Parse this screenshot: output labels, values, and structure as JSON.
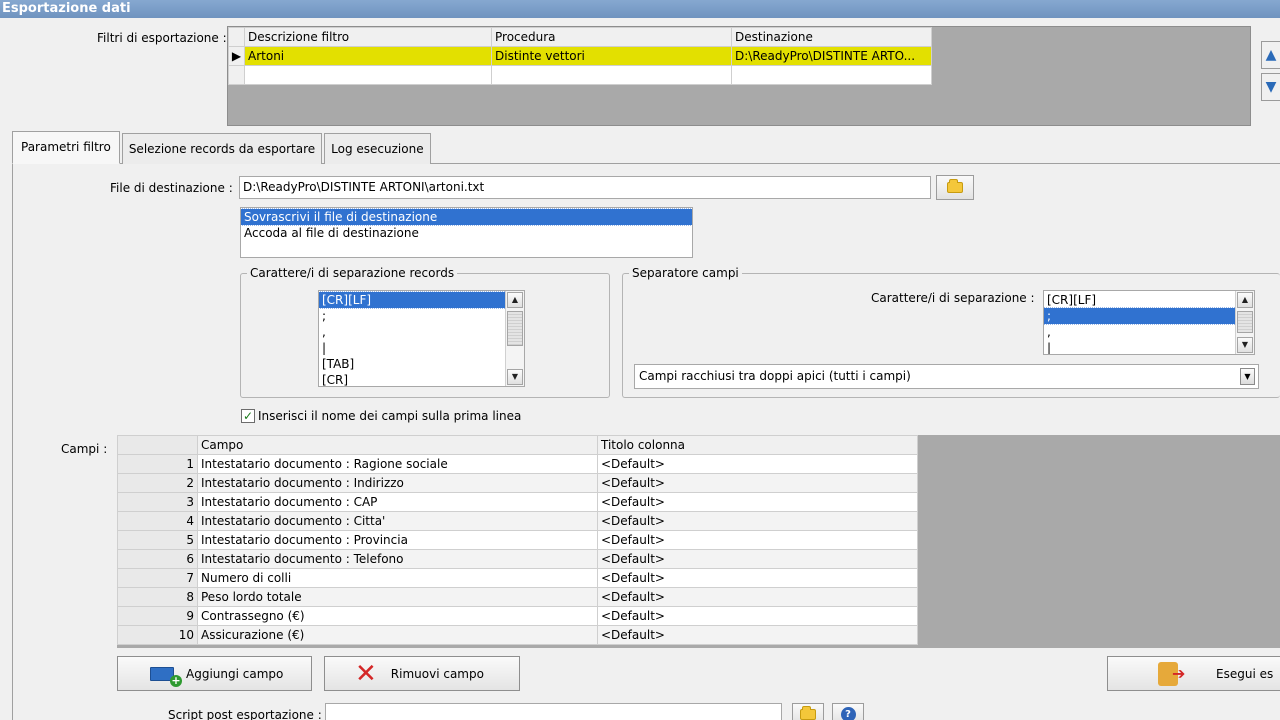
{
  "window": {
    "title": "Esportazione dati"
  },
  "filters": {
    "label": "Filtri di esportazione :",
    "columns": [
      "Descrizione filtro",
      "Procedura",
      "Destinazione"
    ],
    "rows": [
      {
        "descrizione": "Artoni",
        "procedura": "Distinte vettori",
        "destinazione": "D:\\ReadyPro\\DISTINTE ARTO..."
      }
    ]
  },
  "tabs": [
    {
      "label": "Parametri filtro"
    },
    {
      "label": "Selezione records da esportare"
    },
    {
      "label": "Log esecuzione"
    }
  ],
  "file": {
    "label": "File di destinazione :",
    "value": "D:\\ReadyPro\\DISTINTE ARTONI\\artoni.txt",
    "options": [
      "Sovrascrivi il file di destinazione",
      "Accoda al file di destinazione"
    ]
  },
  "record_sep": {
    "group_label": "Carattere/i di separazione records",
    "items": [
      "[CR][LF]",
      ";",
      ",",
      "|",
      "[TAB]",
      "[CR]"
    ]
  },
  "field_sep": {
    "group_label": "Separatore campi",
    "label": "Carattere/i di separazione :",
    "items": [
      "[CR][LF]",
      ";",
      ",",
      "|"
    ],
    "quote_option": "Campi racchiusi tra doppi apici (tutti i campi)"
  },
  "header_checkbox": {
    "label": "Inserisci il nome dei campi sulla prima linea",
    "checked": true
  },
  "campi": {
    "label": "Campi :",
    "columns": [
      "Campo",
      "Titolo colonna"
    ],
    "rows": [
      {
        "n": "1",
        "campo": "Intestatario documento : Ragione sociale",
        "titolo": "<Default>"
      },
      {
        "n": "2",
        "campo": "Intestatario documento : Indirizzo",
        "titolo": "<Default>"
      },
      {
        "n": "3",
        "campo": "Intestatario documento : CAP",
        "titolo": "<Default>"
      },
      {
        "n": "4",
        "campo": "Intestatario documento : Citta'",
        "titolo": "<Default>"
      },
      {
        "n": "5",
        "campo": "Intestatario documento : Provincia",
        "titolo": "<Default>"
      },
      {
        "n": "6",
        "campo": "Intestatario documento : Telefono",
        "titolo": "<Default>"
      },
      {
        "n": "7",
        "campo": "Numero di colli",
        "titolo": "<Default>"
      },
      {
        "n": "8",
        "campo": "Peso lordo totale",
        "titolo": "<Default>"
      },
      {
        "n": "9",
        "campo": "Contrassegno (€)",
        "titolo": "<Default>"
      },
      {
        "n": "10",
        "campo": "Assicurazione (€)",
        "titolo": "<Default>"
      }
    ]
  },
  "buttons": {
    "add": "Aggiungi campo",
    "remove": "Rimuovi campo",
    "execute": "Esegui es"
  },
  "script": {
    "label": "Script post esportazione :",
    "value": ""
  }
}
